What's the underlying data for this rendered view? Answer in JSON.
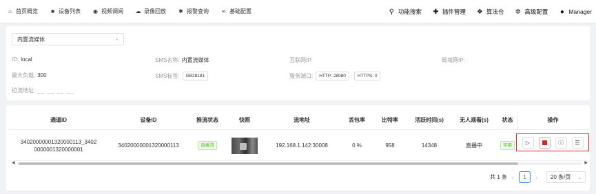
{
  "nav": {
    "items": [
      {
        "label": "首页概览",
        "icon": "home-icon"
      },
      {
        "label": "设备列表",
        "icon": "device-icon"
      },
      {
        "label": "视频调阅",
        "icon": "play-circle-icon"
      },
      {
        "label": "录像回放",
        "icon": "cloud-icon"
      },
      {
        "label": "报警查询",
        "icon": "bug-icon"
      },
      {
        "label": "基础配置",
        "icon": "link-icon"
      }
    ]
  },
  "right_menu": {
    "items": [
      {
        "label": "功能搜索",
        "icon": "search-icon"
      },
      {
        "label": "插件管理",
        "icon": "puzzle-icon"
      },
      {
        "label": "算法仓",
        "icon": "dropbox-icon"
      },
      {
        "label": "高级配置",
        "icon": "gear-icon"
      },
      {
        "label": "Manager",
        "icon": "user-icon"
      }
    ]
  },
  "media_select": {
    "value": "内置流媒体"
  },
  "info": {
    "id_label": "ID:",
    "id_value": "local",
    "sms_name_label": "SMS名称:",
    "sms_name_value": "内置流媒体",
    "internet_ip_label": "互联网IP:",
    "lan_ip_label": "局域网IP:",
    "max_load_label": "最大负载:",
    "max_load_value": "300",
    "sms_tag_label": "SMS标签:",
    "sms_tag_value": "GB28181",
    "service_port_label": "服务端口:",
    "http_port": "HTTP: 28080",
    "https_port": "HTTPS: 0",
    "pull_addr_label": "拉流地址:",
    "pull_addr_value": "__ __ __ __"
  },
  "table": {
    "headers": [
      "通道ID",
      "设备ID",
      "推流状态",
      "快照",
      "流地址",
      "丢包率",
      "比特率",
      "活跃时间(s)",
      "无人观看(s)",
      "状态",
      "操作"
    ],
    "rows": [
      {
        "channel_id": "34020000001320000113_34020000000001320000001",
        "channel_id_line1": "34020000001320000113_3402",
        "channel_id_line2": "0000001320000001",
        "device_id": "34020000001320000113",
        "push_status": "直播流",
        "stream_addr": "192.168.1.142:30008",
        "loss_rate": "0 %",
        "bitrate": "958",
        "active_time": "14348",
        "unwatched": "直播中",
        "status": "可用"
      }
    ]
  },
  "pagination": {
    "total": "共 1 条",
    "current": "1",
    "page_size": "20 条/页"
  },
  "colors": {
    "accent": "#2f7df6",
    "danger": "#e02020",
    "success": "#52c41a"
  }
}
